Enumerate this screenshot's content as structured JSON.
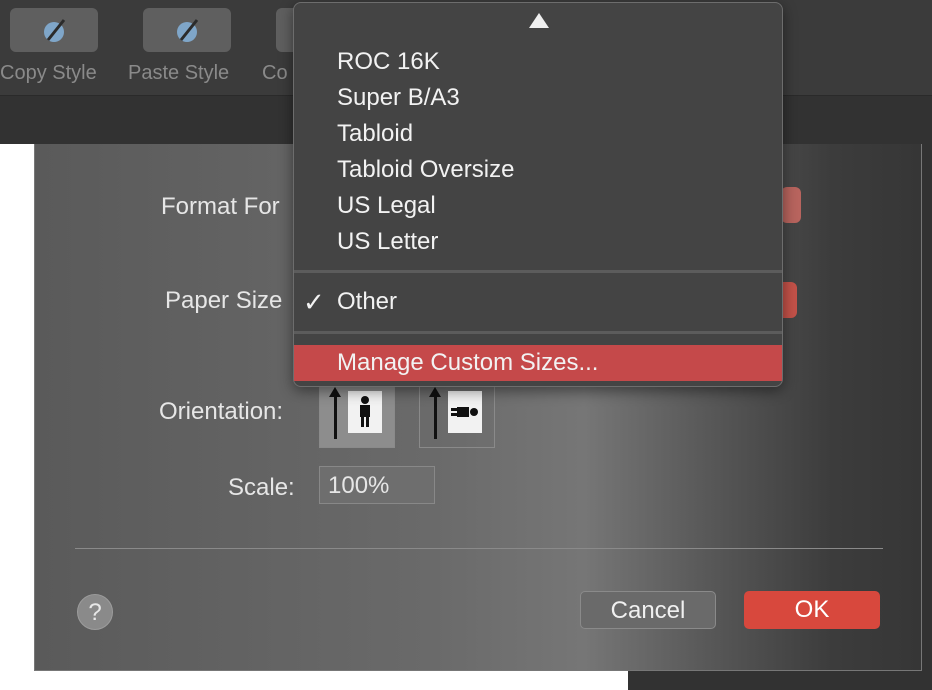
{
  "toolbar": {
    "buttons": [
      {
        "label": "Copy Style",
        "icon": "eyedropper-icon"
      },
      {
        "label": "Paste Style",
        "icon": "eyedropper-icon"
      },
      {
        "label": "Co",
        "icon": "unknown"
      }
    ]
  },
  "dialog": {
    "format_for_label": "Format For",
    "paper_size_label": "Paper Size",
    "orientation_label": "Orientation:",
    "scale_label": "Scale:",
    "scale_value": "100%",
    "help_label": "?",
    "cancel_label": "Cancel",
    "ok_label": "OK"
  },
  "paper_menu": {
    "items": [
      "ROC 16K",
      "Super B/A3",
      "Tabloid",
      "Tabloid Oversize",
      "US Legal",
      "US Letter"
    ],
    "selected": "Other",
    "check_mark": "✓",
    "manage": "Manage Custom Sizes..."
  },
  "colors": {
    "accent": "#d8483d",
    "highlight": "#c5494a",
    "menu_bg": "#444444"
  }
}
